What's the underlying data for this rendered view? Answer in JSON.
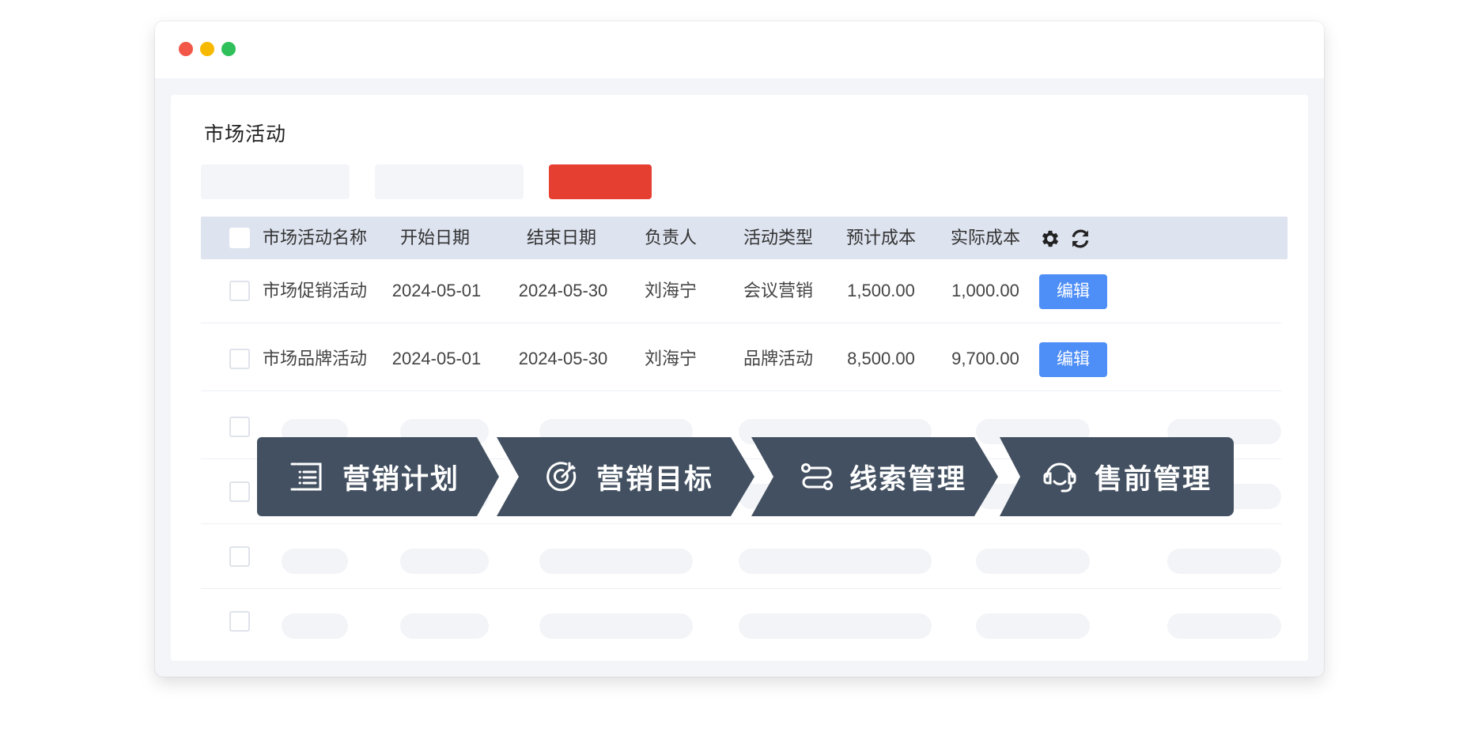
{
  "window": {
    "controls": [
      "close",
      "minimize",
      "maximize"
    ]
  },
  "page": {
    "title": "市场活动"
  },
  "colors": {
    "primary_button": "#e53f31",
    "edit_button": "#4e8ef7",
    "header_bg": "#dde3ef",
    "banner_bg": "#435061"
  },
  "table": {
    "headers": [
      "市场活动名称",
      "开始日期",
      "结束日期",
      "负责人",
      "活动类型",
      "预计成本",
      "实际成本"
    ],
    "header_icons": [
      "gear-icon",
      "refresh-icon"
    ],
    "edit_label": "编辑",
    "rows": [
      {
        "name": "市场促销活动",
        "start": "2024-05-01",
        "end": "2024-05-30",
        "owner": "刘海宁",
        "type": "会议营销",
        "est_cost": "1,500.00",
        "act_cost": "1,000.00"
      },
      {
        "name": "市场品牌活动",
        "start": "2024-05-01",
        "end": "2024-05-30",
        "owner": "刘海宁",
        "type": "品牌活动",
        "est_cost": "8,500.00",
        "act_cost": "9,700.00"
      }
    ]
  },
  "banner": {
    "steps": [
      {
        "label": "营销计划",
        "icon": "list-icon"
      },
      {
        "label": "营销目标",
        "icon": "target-icon"
      },
      {
        "label": "线索管理",
        "icon": "flow-icon"
      },
      {
        "label": "售前管理",
        "icon": "headset-icon"
      }
    ]
  }
}
